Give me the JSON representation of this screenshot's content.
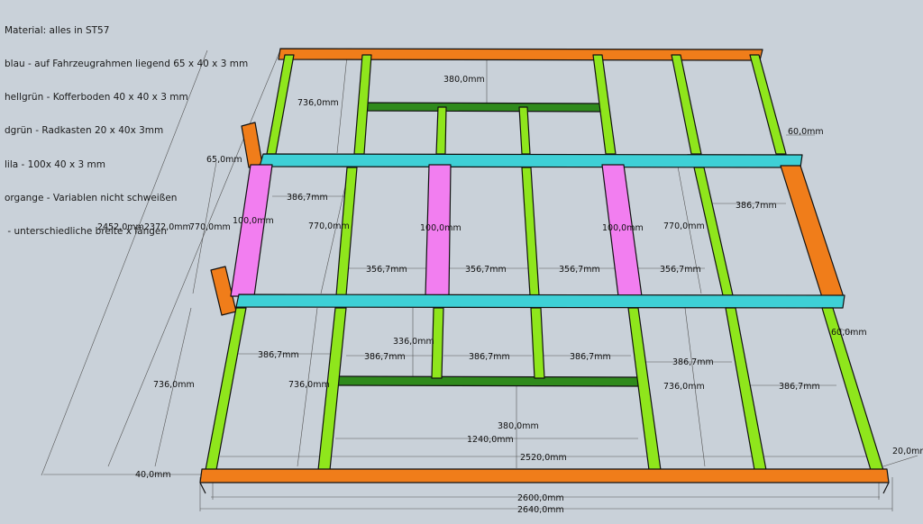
{
  "legend": [
    "Material: alles in ST57",
    "blau - auf Fahrzeugrahmen liegend 65 x 40 x 3 mm",
    "hellgrün - Kofferboden 40 x 40 x 3 mm",
    "dgrün - Radkasten 20 x 40x 3mm",
    "lila - 100x 40 x 3 mm",
    "organge - Variablen nicht schweißen",
    " - unterschiedliche breite x längen"
  ],
  "colors": {
    "background": "#c9d1d9",
    "blue": "#3ed0d6",
    "lightgreen": "#8fe61c",
    "darkgreen": "#2f8a1c",
    "purple": "#f27ef0",
    "orange": "#f07d1a"
  },
  "dimensions": {
    "total_length": "2452,0mm",
    "inner_length": "2372,0mm",
    "middle_section": "770,0mm",
    "end_section": "736,0mm",
    "blue_offset": "65,0mm",
    "wheel_arch_gap": "380,0mm",
    "wheel_arch_depth": "336,0mm",
    "spacing_a": "386,7mm",
    "spacing_b": "356,7mm",
    "purple_width": "100,0mm",
    "edge_60": "60,0mm",
    "edge_20": "20,0mm",
    "edge_40": "40,0mm",
    "wheel_arch_width": "1240,0mm",
    "inner_width": "2520,0mm",
    "width_2600": "2600,0mm",
    "width_2640": "2640,0mm"
  }
}
